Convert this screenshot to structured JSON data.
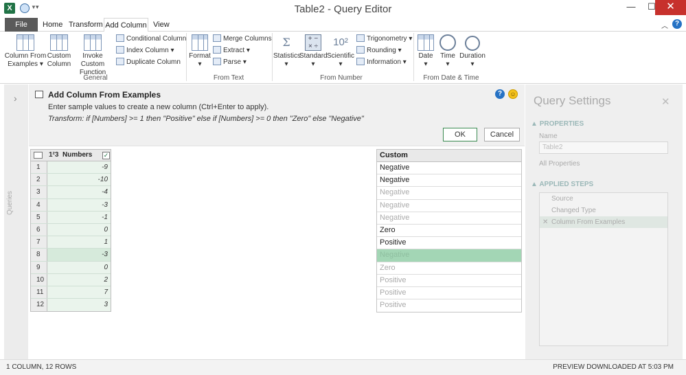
{
  "window": {
    "title": "Table2 - Query Editor",
    "app_icon_letter": "X",
    "min": "—",
    "max": "☐",
    "close": "✕"
  },
  "tabs": [
    "File",
    "Home",
    "Transform",
    "Add Column",
    "View"
  ],
  "ribbon": {
    "general": {
      "label": "General",
      "column_from_examples": "Column From Examples",
      "custom_column": "Custom Column",
      "invoke_custom_function": "Invoke Custom Function",
      "conditional_column": "Conditional Column",
      "index_column": "Index Column",
      "duplicate_column": "Duplicate Column"
    },
    "from_text": {
      "label": "From Text",
      "format": "Format",
      "merge_columns": "Merge Columns",
      "extract": "Extract",
      "parse": "Parse"
    },
    "from_number": {
      "label": "From Number",
      "statistics": "Statistics",
      "standard": "Standard",
      "scientific": "Scientific",
      "trigonometry": "Trigonometry",
      "rounding": "Rounding",
      "information": "Information"
    },
    "from_date_time": {
      "label": "From Date & Time",
      "date": "Date",
      "time": "Time",
      "duration": "Duration"
    }
  },
  "left_nav": {
    "label": "Queries",
    "expand": "›"
  },
  "add_column_panel": {
    "title": "Add Column From Examples",
    "description": "Enter sample values to create a new column (Ctrl+Enter to apply).",
    "transform": "Transform: if [Numbers] >= 1 then \"Positive\" else if [Numbers] >= 0 then \"Zero\" else \"Negative\"",
    "ok": "OK",
    "cancel": "Cancel"
  },
  "grid": {
    "type_label": "1²3",
    "column_name": "Numbers",
    "rows": [
      {
        "idx": "1",
        "value": "-9"
      },
      {
        "idx": "2",
        "value": "-10"
      },
      {
        "idx": "3",
        "value": "-4"
      },
      {
        "idx": "4",
        "value": "-3"
      },
      {
        "idx": "5",
        "value": "-1"
      },
      {
        "idx": "6",
        "value": "0"
      },
      {
        "idx": "7",
        "value": "1"
      },
      {
        "idx": "8",
        "value": "-3"
      },
      {
        "idx": "9",
        "value": "0"
      },
      {
        "idx": "10",
        "value": "2"
      },
      {
        "idx": "11",
        "value": "7"
      },
      {
        "idx": "12",
        "value": "3"
      }
    ]
  },
  "custom_column": {
    "header": "Custom",
    "rows": [
      {
        "value": "Negative",
        "state": "entered"
      },
      {
        "value": "Negative",
        "state": "entered"
      },
      {
        "value": "Negative",
        "state": "suggested"
      },
      {
        "value": "Negative",
        "state": "suggested"
      },
      {
        "value": "Negative",
        "state": "suggested"
      },
      {
        "value": "Zero",
        "state": "entered"
      },
      {
        "value": "Positive",
        "state": "entered"
      },
      {
        "value": "Negative",
        "state": "selected"
      },
      {
        "value": "Zero",
        "state": "suggested"
      },
      {
        "value": "Positive",
        "state": "suggested"
      },
      {
        "value": "Positive",
        "state": "suggested"
      },
      {
        "value": "Positive",
        "state": "suggested"
      }
    ]
  },
  "query_settings": {
    "title": "Query Settings",
    "close": "✕",
    "properties": "PROPERTIES",
    "name_label": "Name",
    "name_value": "Table2",
    "all_properties": "All Properties",
    "applied_steps": "APPLIED STEPS",
    "steps": [
      "Source",
      "Changed Type",
      "Column From Examples"
    ]
  },
  "status": {
    "left": "1 COLUMN, 12 ROWS",
    "right": "PREVIEW DOWNLOADED AT 5:03 PM"
  },
  "colors": {
    "accent_green": "#217346",
    "selection_green": "#a3d6b5",
    "close_red": "#c7312c",
    "help_blue": "#2672c4"
  }
}
